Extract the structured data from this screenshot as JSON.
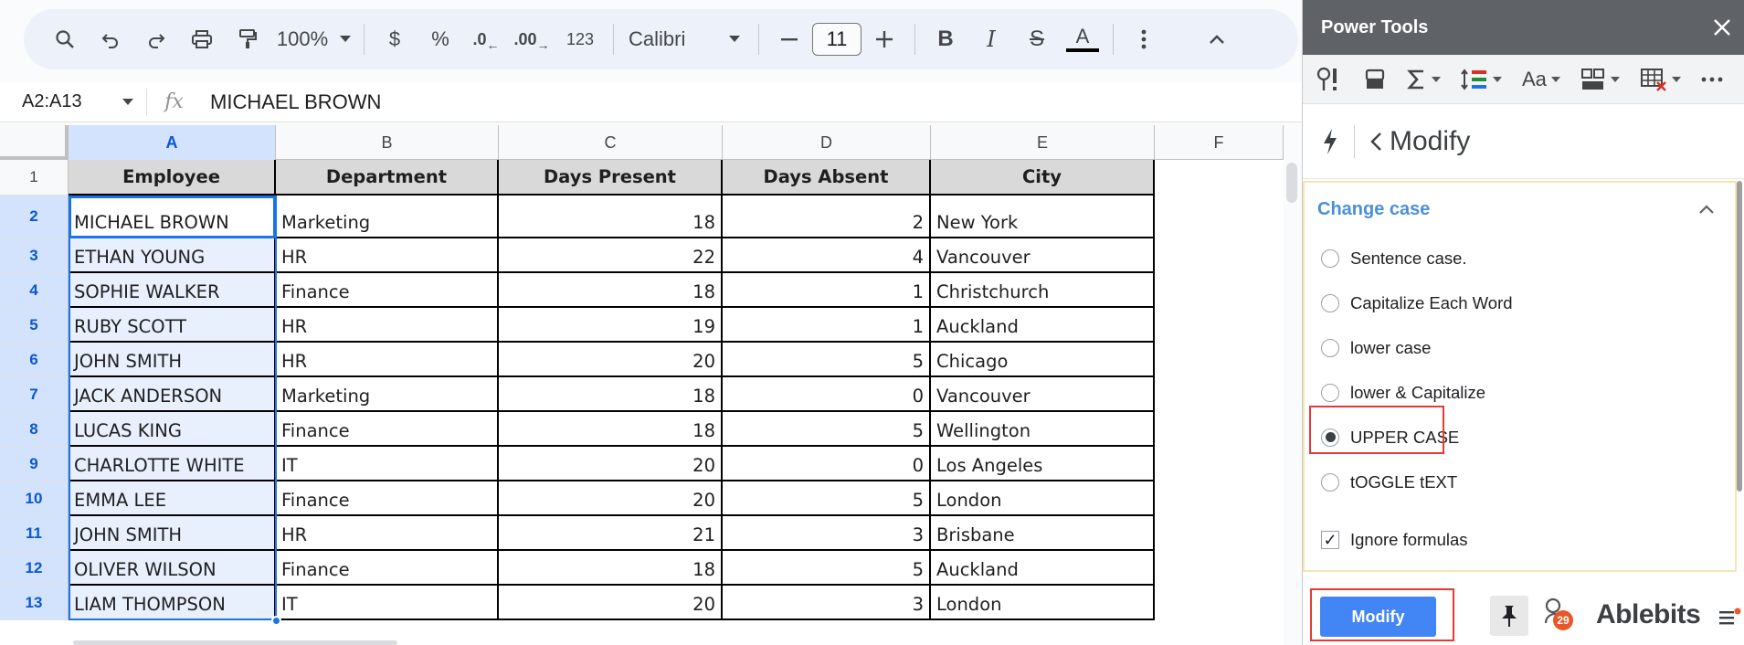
{
  "toolbar": {
    "zoom": "100%",
    "currency": "$",
    "percent": "%",
    "dec_decrease": ".0",
    "dec_increase": ".00",
    "number_format": "123",
    "font": "Calibri",
    "font_size": "11",
    "text_color_label": "A"
  },
  "formula_bar": {
    "name_box": "A2:A13",
    "fx": "fx",
    "content": "MICHAEL BROWN"
  },
  "columns": [
    "A",
    "B",
    "C",
    "D",
    "E",
    "F"
  ],
  "rows": [
    "1",
    "2",
    "3",
    "4",
    "5",
    "6",
    "7",
    "8",
    "9",
    "10",
    "11",
    "12",
    "13"
  ],
  "table": {
    "headers": [
      "Employee",
      "Department",
      "Days Present",
      "Days Absent",
      "City"
    ],
    "data": [
      [
        "MICHAEL BROWN",
        "Marketing",
        "18",
        "2",
        "New York"
      ],
      [
        "ETHAN YOUNG",
        "HR",
        "22",
        "4",
        "Vancouver"
      ],
      [
        "SOPHIE WALKER",
        "Finance",
        "18",
        "1",
        "Christchurch"
      ],
      [
        "RUBY SCOTT",
        "HR",
        "19",
        "1",
        "Auckland"
      ],
      [
        "JOHN SMITH",
        "HR",
        "20",
        "5",
        "Chicago"
      ],
      [
        "JACK ANDERSON",
        "Marketing",
        "18",
        "0",
        "Vancouver"
      ],
      [
        "LUCAS KING",
        "Finance",
        "18",
        "5",
        "Wellington"
      ],
      [
        "CHARLOTTE WHITE",
        "IT",
        "20",
        "0",
        "Los Angeles"
      ],
      [
        "EMMA LEE",
        "Finance",
        "20",
        "5",
        "London"
      ],
      [
        "JOHN SMITH",
        "HR",
        "21",
        "3",
        "Brisbane"
      ],
      [
        "OLIVER WILSON",
        "Finance",
        "18",
        "5",
        "Auckland"
      ],
      [
        "LIAM THOMPSON",
        "IT",
        "20",
        "3",
        "London"
      ]
    ]
  },
  "sidebar": {
    "title": "Power Tools",
    "section": "Modify",
    "group": "Change case",
    "options": [
      {
        "label": "Sentence case.",
        "selected": false
      },
      {
        "label": "Capitalize Each Word",
        "selected": false
      },
      {
        "label": "lower case",
        "selected": false
      },
      {
        "label": "lower & Capitalize",
        "selected": false
      },
      {
        "label": "UPPER CASE",
        "selected": true
      },
      {
        "label": "tOGGLE tEXT",
        "selected": false
      }
    ],
    "ignore_formulas": "Ignore formulas",
    "ignore_formulas_checked": true,
    "modify_button": "Modify",
    "badge_count": "29",
    "brand": "Ablebits"
  },
  "colors": {
    "accent": "#1a73e8",
    "header_fill": "#d9d9d9",
    "selection_fill": "#e8f0fe",
    "sidebar_title_bg": "#5f6368",
    "modify_button": "#4285f4",
    "highlight_box": "#e53935"
  }
}
